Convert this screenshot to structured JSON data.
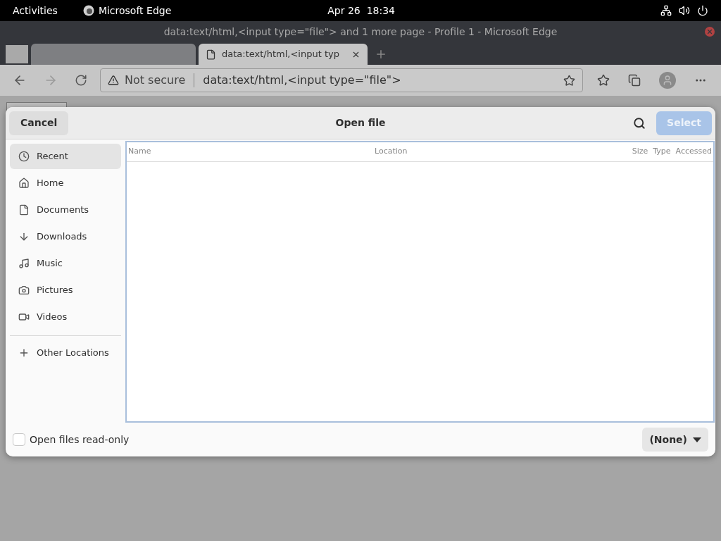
{
  "top_bar": {
    "activities": "Activities",
    "app_name": "Microsoft Edge",
    "clock": "Apr 26  18:34"
  },
  "browser": {
    "window_title": "data:text/html,<input type=\"file\"> and 1 more page - Profile 1 - Microsoft Edge",
    "tabs": [
      {
        "selected": false
      },
      {
        "label": "data:text/html,<input typ",
        "selected": true
      }
    ],
    "address": {
      "security": "Not secure",
      "url": "data:text/html,<input type=\"file\">"
    }
  },
  "dialog": {
    "cancel": "Cancel",
    "title": "Open file",
    "select": {
      "label": "Select",
      "disabled": true
    },
    "places": [
      {
        "label": "Recent",
        "selected": true
      },
      {
        "label": "Home",
        "selected": false
      },
      {
        "label": "Documents",
        "selected": false
      },
      {
        "label": "Downloads",
        "selected": false
      },
      {
        "label": "Music",
        "selected": false
      },
      {
        "label": "Pictures",
        "selected": false
      },
      {
        "label": "Videos",
        "selected": false
      }
    ],
    "other_locations": "Other Locations",
    "columns": [
      "Name",
      "Location",
      "Size",
      "Type",
      "Accessed"
    ],
    "read_only": {
      "label": "Open files read-only",
      "checked": false
    },
    "filter": "(None)"
  }
}
